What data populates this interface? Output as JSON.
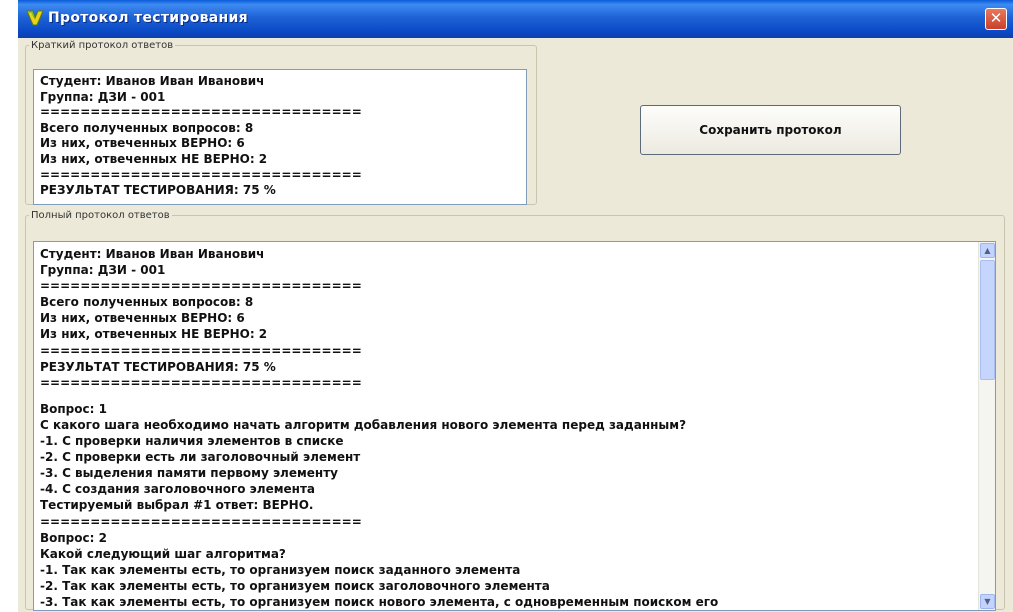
{
  "window": {
    "title": "Протокол тестирования",
    "close_glyph": "✕"
  },
  "summary": {
    "legend": "Краткий протокол ответов",
    "lines": [
      "Студент: Иванов Иван Иванович",
      "Группа: ДЗИ - 001",
      "================================",
      "Всего полученных вопросов: 8",
      "Из них, отвеченных ВЕРНО: 6",
      "Из них, отвеченных НЕ ВЕРНО: 2",
      "================================",
      "РЕЗУЛЬТАТ ТЕСТИРОВАНИЯ: 75 %"
    ]
  },
  "actions": {
    "save_label": "Сохранить протокол"
  },
  "full": {
    "legend": "Полный протокол ответов",
    "header_lines": [
      "Студент: Иванов Иван Иванович",
      "Группа: ДЗИ - 001",
      "================================",
      "Всего полученных вопросов: 8",
      "Из них, отвеченных ВЕРНО: 6",
      "Из них, отвеченных НЕ ВЕРНО: 2",
      "================================",
      "РЕЗУЛЬТАТ ТЕСТИРОВАНИЯ: 75 %",
      "================================"
    ],
    "question1_lines": [
      "Вопрос: 1",
      "С какого шага необходимо начать алгоритм добавления нового элемента перед заданным?",
      "-1. С проверки наличия элементов в списке",
      "-2. С проверки есть ли заголовочный элемент",
      "-3. С выделения памяти первому элементу",
      "-4. С создания заголовочного элемента",
      "Тестируемый выбрал #1 ответ: ВЕРНО.",
      "================================"
    ],
    "question2_lines": [
      "Вопрос: 2",
      "Какой следующий шаг алгоритма?",
      "-1. Так как элементы есть, то организуем поиск заданного элемента",
      "-2. Так как элементы есть, то организуем поиск заголовочного элемента",
      "-3. Так как элементы есть, то организуем поиск нового элемента, с одновременным поиском его"
    ]
  },
  "scrollbar": {
    "up_glyph": "▲",
    "down_glyph": "▼",
    "position": 0.0
  },
  "colors": {
    "titlebar": "#0c4bc7",
    "window_bg": "#ece9d8",
    "close_button": "#c8402a"
  }
}
